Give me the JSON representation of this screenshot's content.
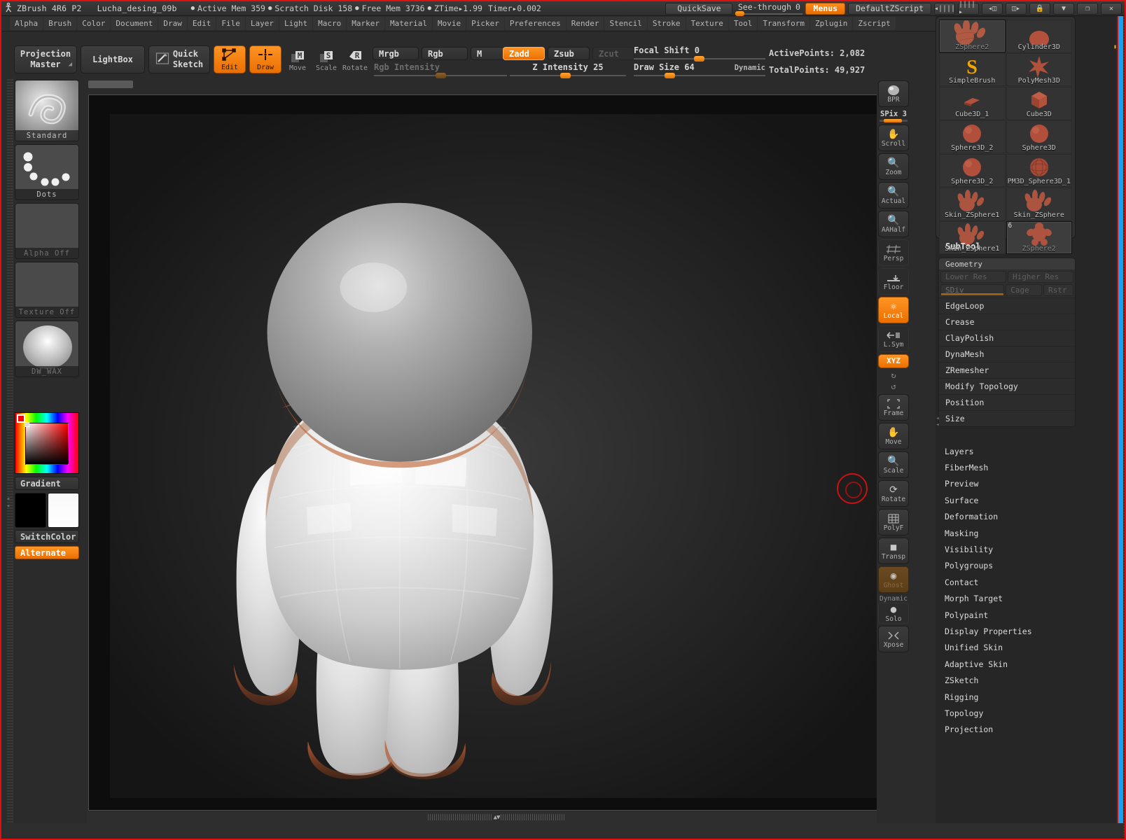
{
  "titlebar": {
    "logo_icon": "zbrush-logo-icon",
    "app_title": "ZBrush 4R6 P2",
    "document_name": "Lucha_desing_09b",
    "stats": [
      "Active Mem 359",
      "Scratch Disk 158",
      "Free Mem 3736"
    ],
    "ztime_label": "ZTime",
    "ztime_value": "1.99",
    "timer_label": "Timer",
    "timer_value": "0.002",
    "quicksave": "QuickSave",
    "seethrough_label": "See-through",
    "seethrough_value": "0",
    "menus_button": "Menus",
    "zscript_button": "DefaultZScript",
    "lock_icon": "lock-icon",
    "minimize_icon": "minimize-icon",
    "restore_icon": "restore-icon",
    "close_icon": "close-icon"
  },
  "menubar": {
    "items": [
      "Alpha",
      "Brush",
      "Color",
      "Document",
      "Draw",
      "Edit",
      "File",
      "Layer",
      "Light",
      "Macro",
      "Marker",
      "Material",
      "Movie",
      "Picker",
      "Preferences",
      "Render",
      "Stencil",
      "Stroke",
      "Texture",
      "Tool",
      "Transform",
      "Zplugin",
      "Zscript"
    ]
  },
  "toolbar": {
    "projection_master": "Projection\nMaster",
    "projection_master_line1": "Projection",
    "projection_master_line2": "Master",
    "lightbox": "LightBox",
    "quick_sketch_line1": "Quick",
    "quick_sketch_line2": "Sketch",
    "edit": "Edit",
    "draw": "Draw",
    "move": "Move",
    "scale": "Scale",
    "rotate": "Rotate",
    "mrgb": "Mrgb",
    "rgb": "Rgb",
    "m": "M",
    "zadd": "Zadd",
    "zsub": "Zsub",
    "zcut": "Zcut",
    "rgb_intensity_label": "Rgb Intensity",
    "z_intensity_label": "Z Intensity 25",
    "focal_shift_label": "Focal Shift 0",
    "draw_size_label": "Draw Size 64",
    "dynamic_label": "Dynamic",
    "active_points": "ActivePoints: 2,082",
    "total_points": "TotalPoints: 49,927"
  },
  "left_panel": {
    "brush": {
      "label": "Standard",
      "icon": "brush-thumbnail"
    },
    "stroke": {
      "label": "Dots",
      "icon": "stroke-thumbnail"
    },
    "alpha": {
      "label": "Alpha Off",
      "icon": "alpha-thumbnail"
    },
    "texture": {
      "label": "Texture Off",
      "icon": "texture-thumbnail"
    },
    "material": {
      "label": "DW_WAX",
      "icon": "material-thumbnail"
    },
    "gradient": "Gradient",
    "switch_color": "SwitchColor",
    "alternate": "Alternate",
    "main_color": "#000000",
    "secondary_color": "#ffffff"
  },
  "right_toolbar": {
    "items": [
      {
        "label": "BPR",
        "icon": "bpr-render-icon",
        "state": "normal"
      },
      {
        "label": "Scroll",
        "icon": "hand-icon",
        "state": "normal"
      },
      {
        "label": "Zoom",
        "icon": "magnifier-icon",
        "state": "normal"
      },
      {
        "label": "Actual",
        "icon": "magnifier-actual-icon",
        "state": "normal"
      },
      {
        "label": "AAHalf",
        "icon": "magnifier-half-icon",
        "state": "normal"
      },
      {
        "label": "Persp",
        "icon": "perspective-icon",
        "state": "flat"
      },
      {
        "label": "Floor",
        "icon": "floor-grid-icon",
        "state": "flat"
      },
      {
        "label": "Local",
        "icon": "local-pivot-icon",
        "state": "on"
      },
      {
        "label": "L.Sym",
        "icon": "local-symmetry-icon",
        "state": "flat"
      },
      {
        "label": "XYZ",
        "icon": "xyz-axis-icon",
        "state": "on"
      },
      {
        "label": "Frame",
        "icon": "frame-icon",
        "state": "normal"
      },
      {
        "label": "Move",
        "icon": "move-hand-icon",
        "state": "normal"
      },
      {
        "label": "Scale",
        "icon": "scale-icon",
        "state": "normal"
      },
      {
        "label": "Rotate",
        "icon": "rotate-icon",
        "state": "normal"
      },
      {
        "label": "PolyF",
        "icon": "polyframe-icon",
        "state": "normal"
      },
      {
        "label": "Transp",
        "icon": "transparency-icon",
        "state": "normal"
      },
      {
        "label": "Ghost",
        "icon": "ghost-icon",
        "state": "dimmed"
      },
      {
        "label": "Solo",
        "icon": "solo-icon",
        "state": "normal"
      },
      {
        "label": "Xpose",
        "icon": "xpose-icon",
        "state": "normal"
      }
    ],
    "spix_label": "SPix 3",
    "dynamic_label": "Dynamic",
    "rotate_cw_icon": "rotate-cw-icon",
    "rotate_ccw_icon": "rotate-ccw-icon"
  },
  "tool_palette": {
    "items": [
      {
        "label": "ZSphere2",
        "icon": "zsphere-hand-thumb",
        "selected": true,
        "number": ""
      },
      {
        "label": "Cylinder3D",
        "icon": "cylinder-thumb",
        "selected": false,
        "number": ""
      },
      {
        "label": "SimpleBrush",
        "icon": "simplebrush-thumb",
        "selected": false,
        "number": ""
      },
      {
        "label": "PolyMesh3D",
        "icon": "star-thumb",
        "selected": false,
        "number": ""
      },
      {
        "label": "Cube3D_1",
        "icon": "cube-flat-thumb",
        "selected": false,
        "number": ""
      },
      {
        "label": "Cube3D",
        "icon": "cube-thumb",
        "selected": false,
        "number": ""
      },
      {
        "label": "Sphere3D_2",
        "icon": "sphere-thumb",
        "selected": false,
        "number": ""
      },
      {
        "label": "Sphere3D",
        "icon": "sphere-thumb",
        "selected": false,
        "number": ""
      },
      {
        "label": "Sphere3D_2",
        "icon": "sphere-thumb",
        "selected": false,
        "number": ""
      },
      {
        "label": "PM3D_Sphere3D_1",
        "icon": "wire-sphere-thumb",
        "selected": false,
        "number": ""
      },
      {
        "label": "Skin_ZSphere1",
        "icon": "zsphere-hand-thumb",
        "selected": false,
        "number": ""
      },
      {
        "label": "Skin_ZSphere",
        "icon": "zsphere-hand-thumb",
        "selected": false,
        "number": ""
      },
      {
        "label": "ZSphere2",
        "icon": "zsphere-body-thumb",
        "selected": true,
        "number": "6"
      }
    ]
  },
  "right_panel": {
    "subtool_title": "SubTool",
    "geometry": {
      "header": "Geometry",
      "lower_res": "Lower Res",
      "higher_res": "Higher Res",
      "sdiv": "SDiv",
      "cage": "Cage",
      "rstr": "Rstr",
      "items": [
        "EdgeLoop",
        "Crease",
        "ClayPolish",
        "DynaMesh",
        "ZRemesher",
        "Modify Topology",
        "Position",
        "Size"
      ]
    },
    "menu_items": [
      "Layers",
      "FiberMesh",
      "Preview",
      "Surface",
      "Deformation",
      "Masking",
      "Visibility",
      "Polygroups",
      "Contact",
      "Morph Target",
      "Polypaint",
      "Display Properties",
      "Unified Skin",
      "Adaptive Skin",
      "ZSketch",
      "Rigging",
      "Topology",
      "Projection"
    ]
  },
  "colors": {
    "accent": "#ea6f00",
    "border_red": "#e01010",
    "panel_bg": "#2b2b2b",
    "blue_strip": "#1aa0f0"
  }
}
